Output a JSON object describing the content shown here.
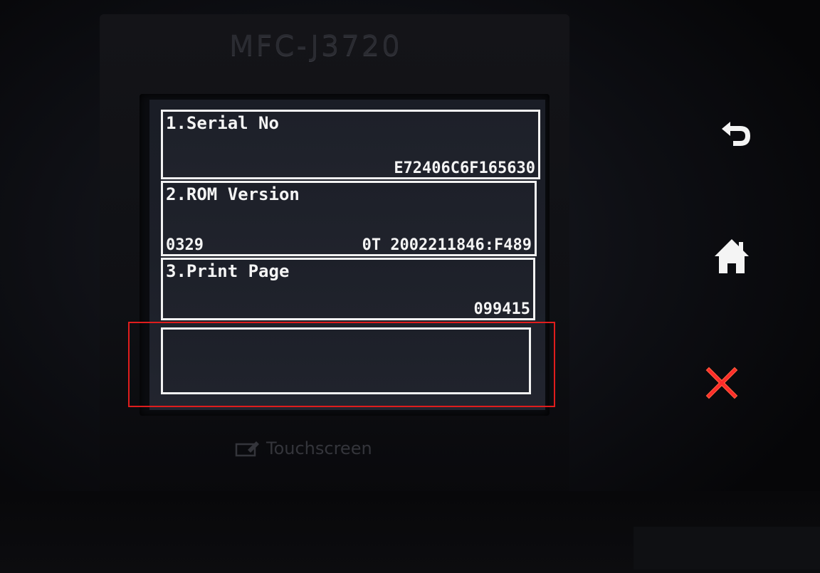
{
  "device": {
    "model": "MFC-J3720",
    "touchscreen_label": "Touchscreen"
  },
  "screen": {
    "rows": [
      {
        "title": "1.Serial No",
        "value_right": "E72406C6F165630",
        "value_left": ""
      },
      {
        "title": "2.ROM Version",
        "value_left": "0329",
        "value_right": "0T 2002211846:F489"
      },
      {
        "title": "3.Print Page",
        "value_left": "",
        "value_right": "099415"
      },
      {
        "title": "",
        "value_left": "",
        "value_right": ""
      }
    ]
  },
  "buttons": {
    "back_icon": "back-arrow-icon",
    "home_icon": "home-icon",
    "cancel_icon": "cancel-x-icon"
  },
  "colors": {
    "screen_bg": "#1c1f28",
    "row_border": "#f2f2f2",
    "highlight": "#e01d1d",
    "cancel": "#ff2a2a"
  }
}
